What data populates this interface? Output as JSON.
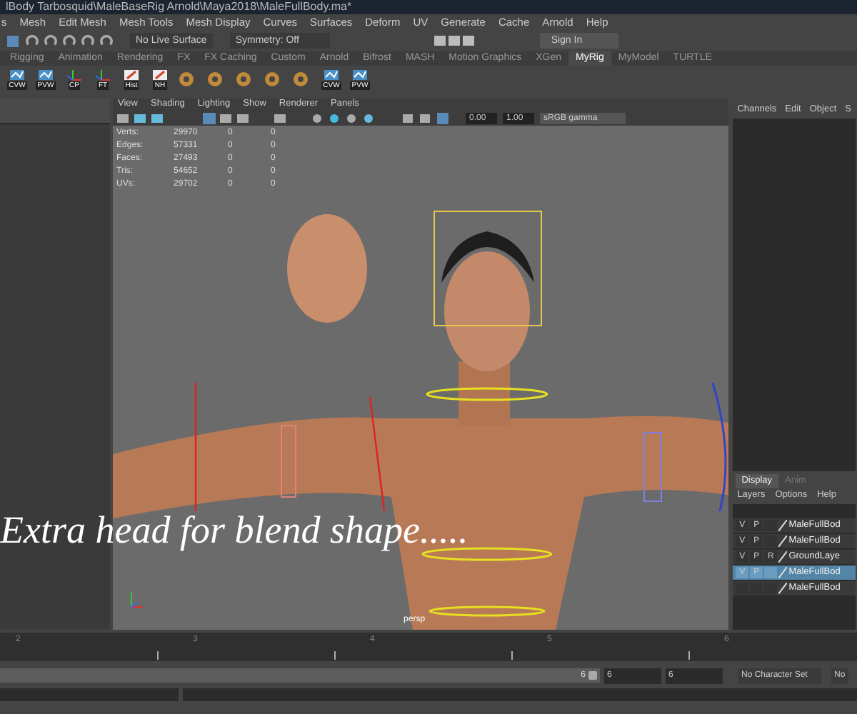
{
  "window": {
    "title": "lBody Tarbosquid\\MaleBaseRig Arnold\\Maya2018\\MaleFullBody.ma*"
  },
  "menu_bar": [
    "s",
    "Mesh",
    "Edit Mesh",
    "Mesh Tools",
    "Mesh Display",
    "Curves",
    "Surfaces",
    "Deform",
    "UV",
    "Generate",
    "Cache",
    "Arnold",
    "Help"
  ],
  "status_line": {
    "live_surface": "No Live Surface",
    "symmetry": "Symmetry: Off",
    "sign_in": "Sign In"
  },
  "shelf_tabs": [
    {
      "label": "Rigging",
      "selected": false
    },
    {
      "label": "Animation",
      "selected": false
    },
    {
      "label": "Rendering",
      "selected": false
    },
    {
      "label": "FX",
      "selected": false
    },
    {
      "label": "FX Caching",
      "selected": false
    },
    {
      "label": "Custom",
      "selected": false
    },
    {
      "label": "Arnold",
      "selected": false
    },
    {
      "label": "Bifrost",
      "selected": false
    },
    {
      "label": "MASH",
      "selected": false
    },
    {
      "label": "Motion Graphics",
      "selected": false
    },
    {
      "label": "XGen",
      "selected": false
    },
    {
      "label": "MyRig",
      "selected": true
    },
    {
      "label": "MyModel",
      "selected": false
    },
    {
      "label": "TURTLE",
      "selected": false
    }
  ],
  "shelf_buttons": [
    {
      "kind": "curve",
      "label": "CVW"
    },
    {
      "kind": "curve",
      "label": "PVW"
    },
    {
      "kind": "axis",
      "label": "CP"
    },
    {
      "kind": "axis",
      "label": "FT"
    },
    {
      "kind": "note",
      "label": "Hist"
    },
    {
      "kind": "note",
      "label": "NH"
    },
    {
      "kind": "tool"
    },
    {
      "kind": "tool"
    },
    {
      "kind": "tool"
    },
    {
      "kind": "tool"
    },
    {
      "kind": "tool"
    },
    {
      "kind": "curve",
      "label": "CVW"
    },
    {
      "kind": "curve",
      "label": "PVW"
    }
  ],
  "viewport": {
    "menu": [
      "View",
      "Shading",
      "Lighting",
      "Show",
      "Renderer",
      "Panels"
    ],
    "exposure": "0.00",
    "gamma": "1.00",
    "color_space": "sRGB gamma",
    "hud": [
      [
        "Verts:",
        "29970",
        "0",
        "0"
      ],
      [
        "Edges:",
        "57331",
        "0",
        "0"
      ],
      [
        "Faces:",
        "27493",
        "0",
        "0"
      ],
      [
        "Tris:",
        "54652",
        "0",
        "0"
      ],
      [
        "UVs:",
        "29702",
        "0",
        "0"
      ]
    ],
    "camera": "persp"
  },
  "caption": "Extra head for blend shape.....",
  "channel_box": {
    "menu": [
      "Channels",
      "Edit",
      "Object",
      "S"
    ]
  },
  "layer_editor": {
    "tabs": [
      {
        "label": "Display",
        "selected": true
      },
      {
        "label": "Anim",
        "selected": false
      }
    ],
    "menu": [
      "Layers",
      "Options",
      "Help"
    ],
    "layers": [
      {
        "v": "V",
        "p": "P",
        "name": "MaleFullBod",
        "selected": false
      },
      {
        "v": "V",
        "p": "P",
        "name": "MaleFullBod",
        "selected": false
      },
      {
        "v": "V",
        "p": "P",
        "r": "R",
        "name": "GroundLaye",
        "selected": false
      },
      {
        "v": "V",
        "p": "P",
        "name": "MaleFullBod",
        "selected": true
      },
      {
        "name": "MaleFullBod",
        "selected": false
      }
    ]
  },
  "timeline": {
    "ticks": [
      "2",
      "3",
      "4",
      "5",
      "6"
    ]
  },
  "range_slider": {
    "level": 1,
    "end_value": "6",
    "field_1": "6",
    "field_2": "6",
    "character_set": "No Character Set",
    "field_3": "No"
  }
}
